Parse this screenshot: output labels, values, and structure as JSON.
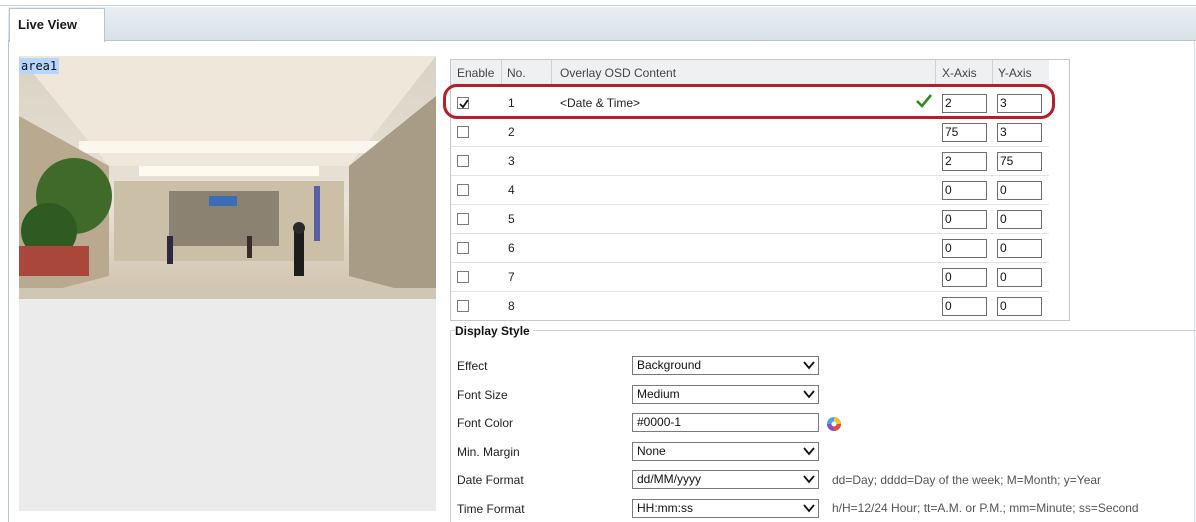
{
  "tab": {
    "label": "Live View"
  },
  "preview": {
    "area_label": "area1"
  },
  "osd_table": {
    "headers": {
      "enable": "Enable",
      "no": "No.",
      "content": "Overlay OSD Content",
      "x": "X-Axis",
      "y": "Y-Axis"
    },
    "rows": [
      {
        "enabled": true,
        "no": "1",
        "content": "<Date & Time>",
        "x": "2",
        "y": "3"
      },
      {
        "enabled": false,
        "no": "2",
        "content": "",
        "x": "75",
        "y": "3"
      },
      {
        "enabled": false,
        "no": "3",
        "content": "",
        "x": "2",
        "y": "75"
      },
      {
        "enabled": false,
        "no": "4",
        "content": "",
        "x": "0",
        "y": "0"
      },
      {
        "enabled": false,
        "no": "5",
        "content": "",
        "x": "0",
        "y": "0"
      },
      {
        "enabled": false,
        "no": "6",
        "content": "",
        "x": "0",
        "y": "0"
      },
      {
        "enabled": false,
        "no": "7",
        "content": "",
        "x": "0",
        "y": "0"
      },
      {
        "enabled": false,
        "no": "8",
        "content": "",
        "x": "0",
        "y": "0"
      }
    ]
  },
  "display_style": {
    "title": "Display Style",
    "effect": {
      "label": "Effect",
      "value": "Background"
    },
    "font_size": {
      "label": "Font Size",
      "value": "Medium"
    },
    "font_color": {
      "label": "Font Color",
      "value": "#0000-1"
    },
    "min_margin": {
      "label": "Min. Margin",
      "value": "None"
    },
    "date_format": {
      "label": "Date Format",
      "value": "dd/MM/yyyy",
      "hint": "dd=Day; dddd=Day of the week; M=Month; y=Year"
    },
    "time_format": {
      "label": "Time Format",
      "value": "HH:mm:ss",
      "hint": "h/H=12/24 Hour; tt=A.M. or P.M.; mm=Minute; ss=Second"
    }
  },
  "colors": {
    "highlight": "#b3202a",
    "check_green": "#2e8b1e",
    "area_label_bg": "#b6d5ff"
  }
}
